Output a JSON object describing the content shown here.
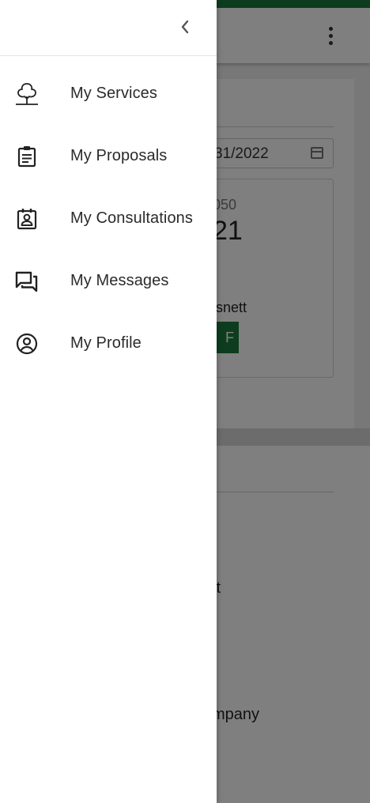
{
  "drawer": {
    "collapse_icon": "chevron-left-icon",
    "items": [
      {
        "label": "My Services",
        "icon": "tree-icon"
      },
      {
        "label": "My Proposals",
        "icon": "clipboard-icon"
      },
      {
        "label": "My Consultations",
        "icon": "contact-badge-icon"
      },
      {
        "label": "My Messages",
        "icon": "chat-bubbles-icon"
      },
      {
        "label": "My Profile",
        "icon": "user-circle-icon"
      }
    ]
  },
  "background": {
    "date_value": "31/2022",
    "number_small": "050",
    "number_large": "21",
    "name_text": "isnett",
    "button_text": "F",
    "text_a": "tt",
    "text_b": "mpany"
  },
  "colors": {
    "brand_green": "#1b7a3c",
    "scrim": "rgba(0,0,0,0.5)",
    "drawer_bg": "#ffffff",
    "text": "#2b2b2b"
  }
}
